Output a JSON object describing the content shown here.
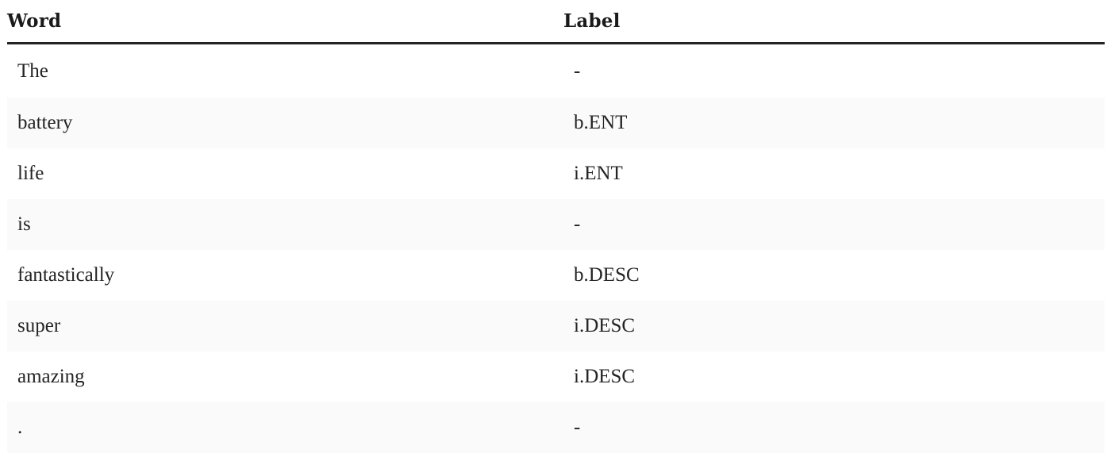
{
  "table": {
    "headers": [
      "Word",
      "Label"
    ],
    "rows": [
      {
        "word": "The",
        "label": "-"
      },
      {
        "word": "battery",
        "label": "b.ENT"
      },
      {
        "word": "life",
        "label": "i.ENT"
      },
      {
        "word": "is",
        "label": "-"
      },
      {
        "word": "fantastically",
        "label": "b.DESC"
      },
      {
        "word": "super",
        "label": "i.DESC"
      },
      {
        "word": "amazing",
        "label": "i.DESC"
      },
      {
        "word": ".",
        "label": "-"
      }
    ]
  },
  "colors": {
    "text": "#242424",
    "header_rule": "#242424",
    "stripe": "#fafafa",
    "background": "#ffffff"
  }
}
